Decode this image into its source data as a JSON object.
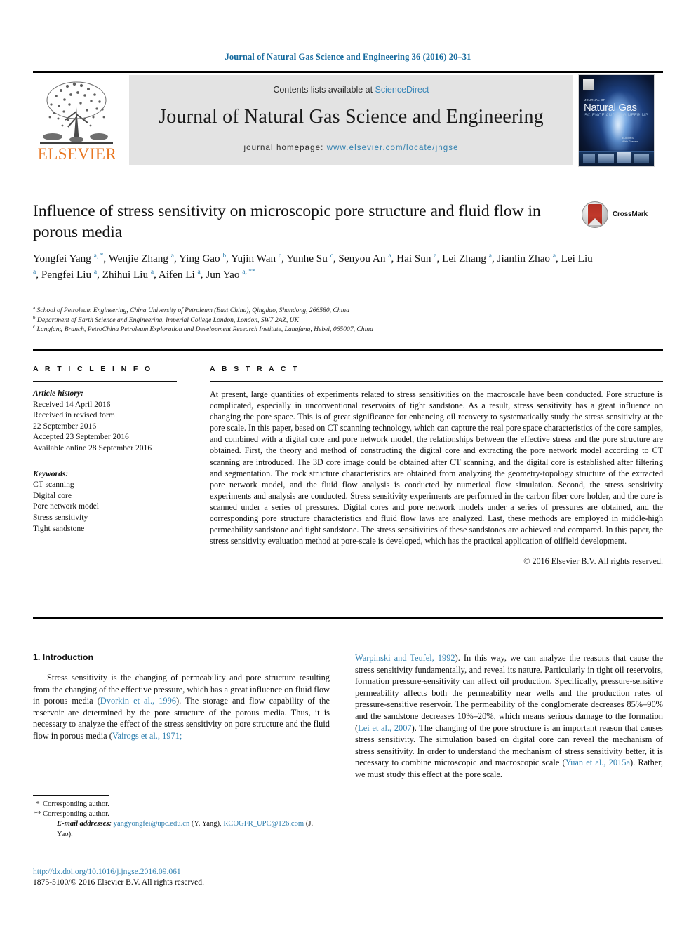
{
  "running_head": "Journal of Natural Gas Science and Engineering 36 (2016) 20–31",
  "masthead": {
    "contents_prefix": "Contents lists available at ",
    "sciencedirect": "ScienceDirect",
    "journal_title": "Journal of Natural Gas Science and Engineering",
    "homepage_prefix": "journal homepage: ",
    "homepage_url": "www.elsevier.com/locate/jngse",
    "publisher": "ELSEVIER",
    "link_color": "#2f7fae",
    "band_color": "#e3e3e3"
  },
  "cover": {
    "top_label": "ELSEVIER",
    "kicker": "JOURNAL OF",
    "title": "Natural Gas",
    "subtitle": "SCIENCE AND ENGINEERING",
    "editor_line": "EDITORS\nAlirio Guevara"
  },
  "crossmark": {
    "label": "CrossMark"
  },
  "article": {
    "title": "Influence of stress sensitivity on microscopic pore structure and fluid flow in porous media",
    "authors_line_1": "Yongfei Yang ",
    "authors_html": "Yongfei Yang <sup>a, *</sup>, Wenjie Zhang <sup>a</sup>, Ying Gao <sup>b</sup>, Yujin Wan <sup>c</sup>, Yunhe Su <sup>c</sup>, Senyou An <sup>a</sup>, Hai Sun <sup>a</sup>, Lei Zhang <sup>a</sup>, Jianlin Zhao <sup>a</sup>, Lei Liu <sup>a</sup>, Pengfei Liu <sup>a</sup>, Zhihui Liu <sup>a</sup>, Aifen Li <sup>a</sup>, Jun Yao <sup>a, **</sup>",
    "affiliations": [
      {
        "marker": "a",
        "text": "School of Petroleum Engineering, China University of Petroleum (East China), Qingdao, Shandong, 266580, China"
      },
      {
        "marker": "b",
        "text": "Department of Earth Science and Engineering, Imperial College London, London, SW7 2AZ, UK"
      },
      {
        "marker": "c",
        "text": "Langfang Branch, PetroChina Petroleum Exploration and Development Research Institute, Langfang, Hebei, 065007, China"
      }
    ]
  },
  "article_info": {
    "heading": "A R T I C L E  I N F O",
    "history_label": "Article history:",
    "history": [
      "Received 14 April 2016",
      "Received in revised form",
      "22 September 2016",
      "Accepted 23 September 2016",
      "Available online 28 September 2016"
    ],
    "keywords_label": "Keywords:",
    "keywords": [
      "CT scanning",
      "Digital core",
      "Pore network model",
      "Stress sensitivity",
      "Tight sandstone"
    ]
  },
  "abstract": {
    "heading": "A B S T R A C T",
    "text": "At present, large quantities of experiments related to stress sensitivities on the macroscale have been conducted. Pore structure is complicated, especially in unconventional reservoirs of tight sandstone. As a result, stress sensitivity has a great influence on changing the pore space. This is of great significance for enhancing oil recovery to systematically study the stress sensitivity at the pore scale. In this paper, based on CT scanning technology, which can capture the real pore space characteristics of the core samples, and combined with a digital core and pore network model, the relationships between the effective stress and the pore structure are obtained. First, the theory and method of constructing the digital core and extracting the pore network model according to CT scanning are introduced. The 3D core image could be obtained after CT scanning, and the digital core is established after filtering and segmentation. The rock structure characteristics are obtained from analyzing the geometry-topology structure of the extracted pore network model, and the fluid flow analysis is conducted by numerical flow simulation. Second, the stress sensitivity experiments and analysis are conducted. Stress sensitivity experiments are performed in the carbon fiber core holder, and the core is scanned under a series of pressures. Digital cores and pore network models under a series of pressures are obtained, and the corresponding pore structure characteristics and fluid flow laws are analyzed. Last, these methods are employed in middle-high permeability sandstone and tight sandstone. The stress sensitivities of these sandstones are achieved and compared. In this paper, the stress sensitivity evaluation method at pore-scale is developed, which has the practical application of oilfield development.",
    "copyright": "© 2016 Elsevier B.V. All rights reserved."
  },
  "introduction": {
    "heading": "1. Introduction",
    "left_paragraph_pre": "Stress sensitivity is the changing of permeability and pore structure resulting from the changing of the effective pressure, which has a great influence on fluid flow in porous media (",
    "left_cite_1": "Dvorkin et al., 1996",
    "left_paragraph_mid": "). The storage and flow capability of the reservoir are determined by the pore structure of the porous media. Thus, it is necessary to analyze the effect of the stress sensitivity on pore structure and the fluid flow in porous media (",
    "left_cite_2": "Vairogs et al., 1971;",
    "right_cite_1": "Warpinski and Teufel, 1992",
    "right_paragraph_1": "). In this way, we can analyze the reasons that cause the stress sensitivity fundamentally, and reveal its nature. Particularly in tight oil reservoirs, formation pressure-sensitivity can affect oil production. Specifically, pressure-sensitive permeability affects both the permeability near wells and the production rates of pressure-sensitive reservoir. The permeability of the conglomerate decreases 85%–90% and the sandstone decreases 10%–20%, which means serious damage to the formation (",
    "right_cite_2": "Lei et al., 2007",
    "right_paragraph_2": "). The changing of the pore structure is an important reason that causes stress sensitivity. The simulation based on digital core can reveal the mechanism of stress sensitivity. In order to understand the mechanism of stress sensitivity better, it is necessary to combine microscopic and macroscopic scale (",
    "right_cite_3": "Yuan et al., 2015a",
    "right_paragraph_3": "). Rather, we must study this effect at the pore scale."
  },
  "footnotes": {
    "corresponding_1": "Corresponding author.",
    "corresponding_2": "Corresponding author.",
    "email_label": "E-mail addresses:",
    "email_1": "yangyongfei@upc.edu.cn",
    "email_1_owner": "(Y. Yang),",
    "email_2": "RCOGFR_UPC@126.com",
    "email_2_owner": "(J. Yao).",
    "doi": "http://dx.doi.org/10.1016/j.jngse.2016.09.061",
    "issn_line": "1875-5100/© 2016 Elsevier B.V. All rights reserved."
  }
}
